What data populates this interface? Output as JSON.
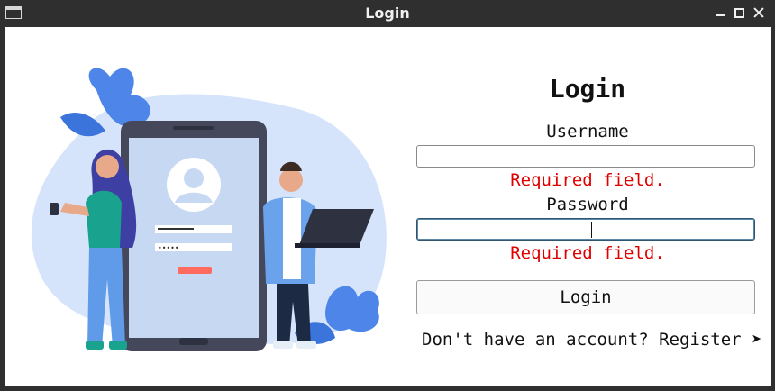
{
  "window": {
    "title": "Login"
  },
  "form": {
    "heading": "Login",
    "username_label": "Username",
    "username_value": "",
    "username_error": "Required field.",
    "password_label": "Password",
    "password_value": "",
    "password_error": "Required field.",
    "login_button": "Login",
    "register_link": "Don't have an account? Register ➤"
  },
  "colors": {
    "error": "#e00000",
    "accent_blue": "#3d7be0",
    "titlebar": "#2f2f2f"
  },
  "illustration": {
    "phone_password_dots": "•••••"
  }
}
